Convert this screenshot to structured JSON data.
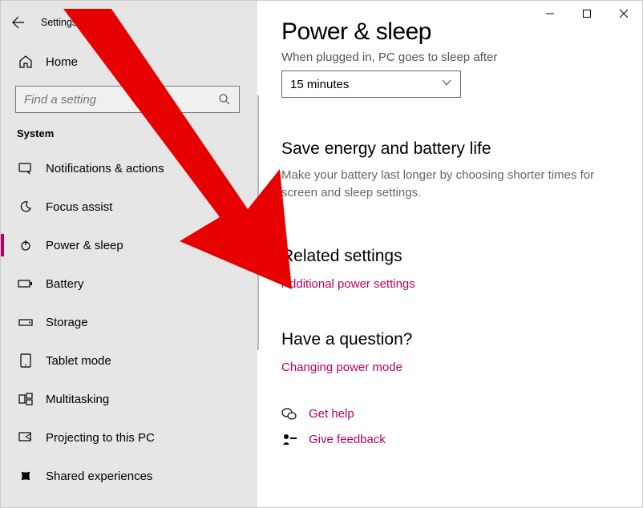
{
  "app_title": "Settings",
  "home_label": "Home",
  "search": {
    "placeholder": "Find a setting"
  },
  "section_label": "System",
  "nav": [
    {
      "label": "Notifications & actions",
      "key": "notifications"
    },
    {
      "label": "Focus assist",
      "key": "focus-assist"
    },
    {
      "label": "Power & sleep",
      "key": "power-sleep"
    },
    {
      "label": "Battery",
      "key": "battery"
    },
    {
      "label": "Storage",
      "key": "storage"
    },
    {
      "label": "Tablet mode",
      "key": "tablet-mode"
    },
    {
      "label": "Multitasking",
      "key": "multitasking"
    },
    {
      "label": "Projecting to this PC",
      "key": "projecting"
    },
    {
      "label": "Shared experiences",
      "key": "shared"
    }
  ],
  "main": {
    "title": "Power & sleep",
    "subline": "When plugged in, PC goes to sleep after",
    "dropdown_value": "15 minutes",
    "energy": {
      "heading": "Save energy and battery life",
      "desc": "Make your battery last longer by choosing shorter times for screen and sleep settings."
    },
    "related": {
      "heading": "Related settings",
      "link": "Additional power settings"
    },
    "question": {
      "heading": "Have a question?",
      "link": "Changing power mode"
    },
    "help": {
      "get_help": "Get help",
      "feedback": "Give feedback"
    }
  }
}
